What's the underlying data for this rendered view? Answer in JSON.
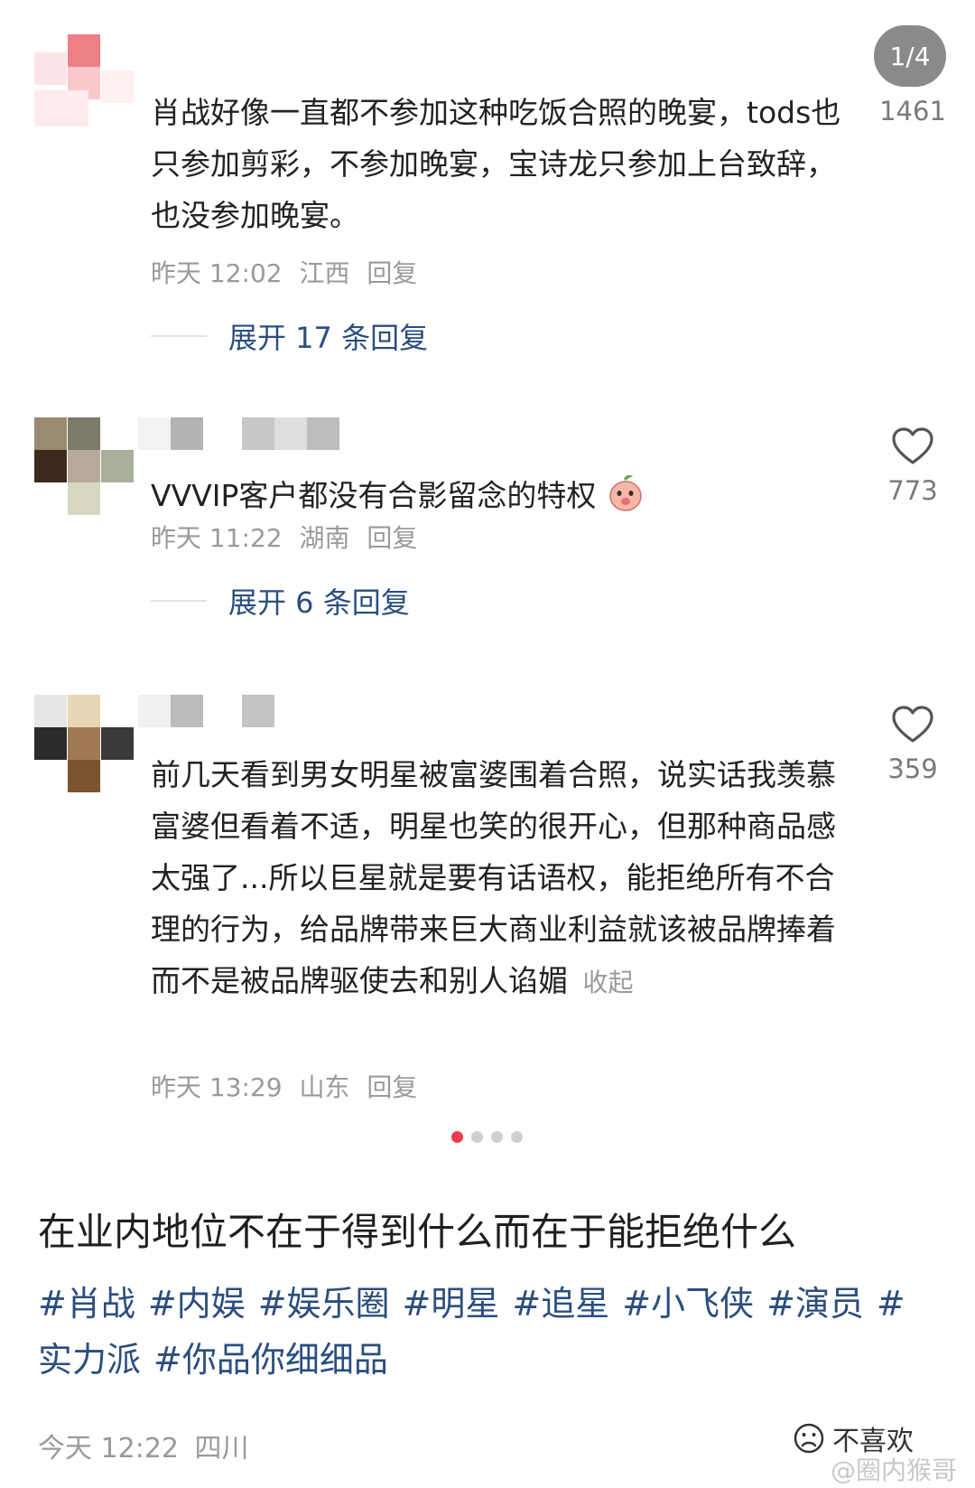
{
  "pager": "1/4",
  "comments": [
    {
      "text": "肖战好像一直都不参加这种吃饭合照的晚宴，tods也只参加剪彩，不参加晚宴，宝诗龙只参加上台致辞，也没参加晚宴。",
      "time": "昨天 12:02",
      "location": "江西",
      "reply": "回复",
      "likes": "1461",
      "expand": "展开 17 条回复"
    },
    {
      "text": "VVVIP客户都没有合影留念的特权",
      "time": "昨天 11:22",
      "location": "湖南",
      "reply": "回复",
      "likes": "773",
      "expand": "展开 6 条回复"
    },
    {
      "text": "前几天看到男女明星被富婆围着合照，说实话我羡慕富婆但看着不适，明星也笑的很开心，但那种商品感太强了...所以巨星就是要有话语权，能拒绝所有不合理的行为，给品牌带来巨大商业利益就该被品牌捧着而不是被品牌驱使去和别人谄媚",
      "collapse": "收起",
      "time": "昨天 13:29",
      "location": "山东",
      "reply": "回复",
      "likes": "359"
    }
  ],
  "post": {
    "title": "在业内地位不在于得到什么而在于能拒绝什么",
    "tags": [
      "#肖战",
      "#内娱",
      "#娱乐圈",
      "#明星",
      "#追星",
      "#小飞侠",
      "#演员",
      "#实力派",
      "#你品你细细品"
    ],
    "time": "今天 12:22",
    "location": "四川",
    "dislike": "不喜欢"
  },
  "watermark": "@圈内猴哥",
  "colors": {
    "link": "#2b4e7e",
    "meta": "#9a9a9a",
    "active_dot": "#ee3b4d"
  },
  "icons": {
    "like": "heart-outline-icon",
    "emoji": "peach-emoji-icon",
    "dislike": "sad-face-icon"
  }
}
